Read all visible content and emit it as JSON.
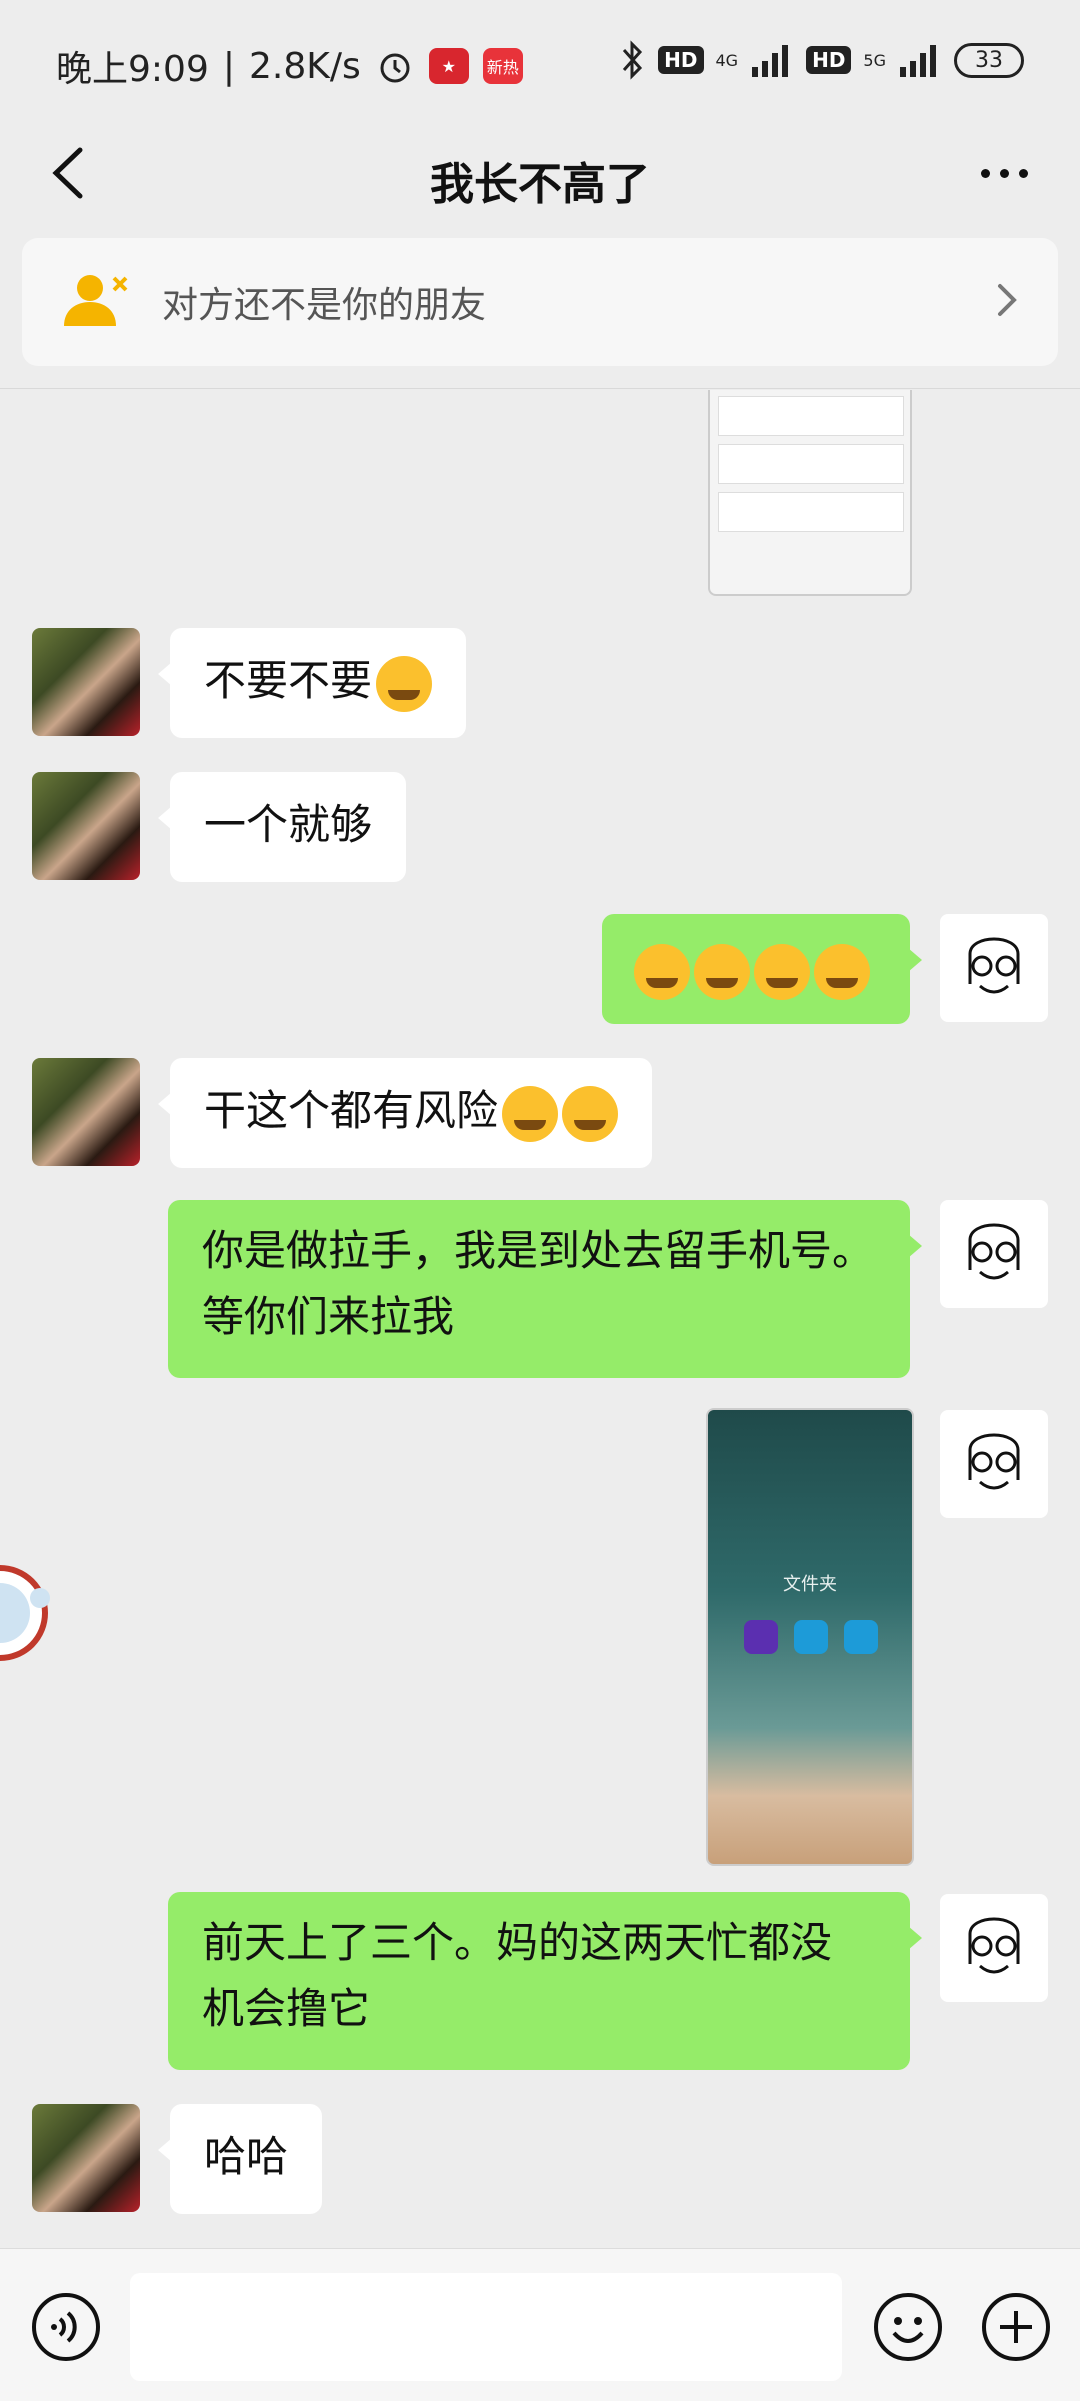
{
  "status_bar": {
    "time": "晚上9:09",
    "speed": "2.8K/s",
    "badge_hot": "新热",
    "net1": "4G",
    "net2": "5G",
    "hd1": "HD",
    "hd2": "HD",
    "battery": "33"
  },
  "header": {
    "title": "我长不高了"
  },
  "stranger_banner": {
    "text": "对方还不是你的朋友"
  },
  "messages": [
    {
      "side": "in",
      "text": "不要不要",
      "emoji": "grin"
    },
    {
      "side": "in",
      "text": "一个就够"
    },
    {
      "side": "out",
      "emoji_only": "tears-of-joy x4"
    },
    {
      "side": "in",
      "text": "干这个都有风险",
      "emoji": "crying"
    },
    {
      "side": "out",
      "line1": "你是做拉手，我是到处去留手机号。",
      "line2": "等你们来拉我"
    },
    {
      "side": "out",
      "image": "phone-screenshot",
      "image_caption": "文件夹"
    },
    {
      "side": "out",
      "line1": "前天上了三个。妈的这两天忙都没",
      "line2": "机会撸它"
    },
    {
      "side": "in",
      "text": "哈哈"
    }
  ],
  "colors": {
    "bg": "#ededed",
    "out_bubble": "#95ec69",
    "in_bubble": "#ffffff",
    "stranger_icon": "#f5b400"
  }
}
